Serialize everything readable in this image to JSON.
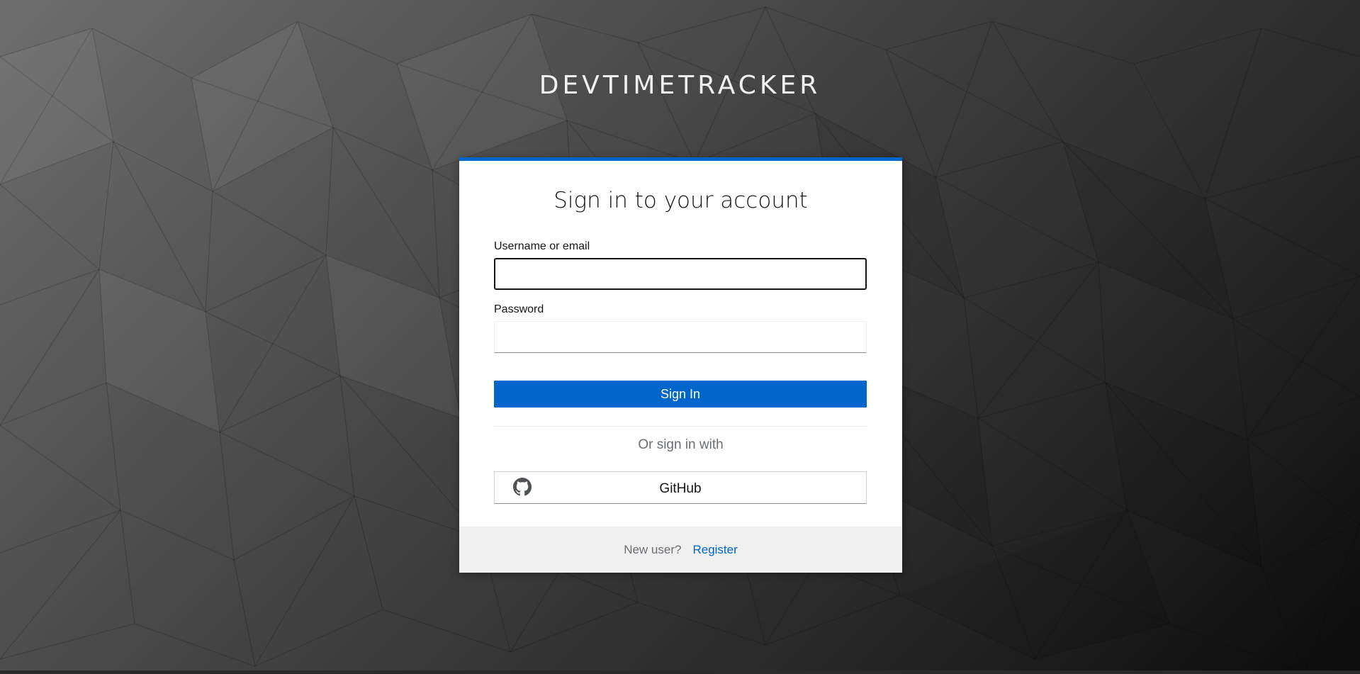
{
  "brand": {
    "title": "DEVTIMETRACKER"
  },
  "login": {
    "heading": "Sign in to your account",
    "username_label": "Username or email",
    "username_value": "",
    "password_label": "Password",
    "password_value": "",
    "signin_label": "Sign In",
    "alt_heading": "Or sign in with",
    "providers": [
      {
        "label": "GitHub",
        "icon": "github-icon"
      }
    ]
  },
  "footer": {
    "new_user_text": "New user?",
    "register_label": "Register"
  },
  "colors": {
    "accent": "#0066cc",
    "footer_bg": "#f0f0f0",
    "background_light": "#6e6e6e",
    "background_dark": "#0b0b0b"
  }
}
